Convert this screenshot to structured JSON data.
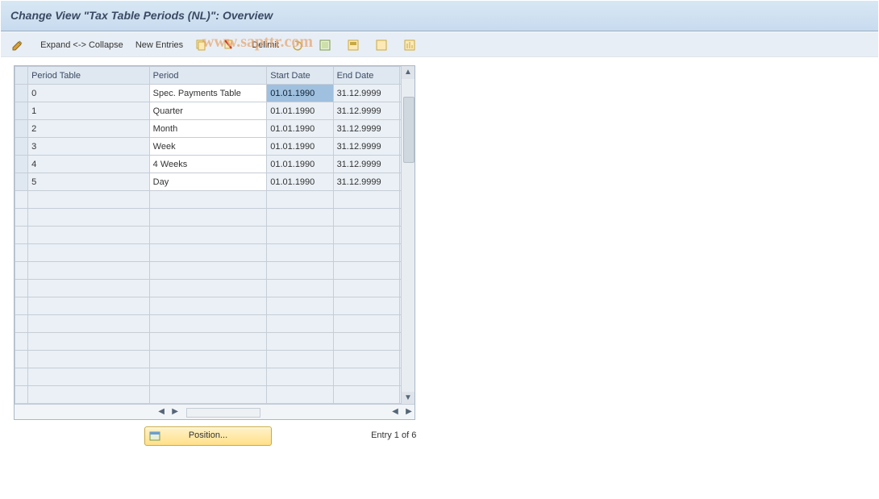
{
  "title": "Change View \"Tax Table Periods (NL)\": Overview",
  "watermark": "www.sapttr.com",
  "toolbar": {
    "expand_collapse": "Expand <-> Collapse",
    "new_entries": "New Entries",
    "delimit": "Delimit"
  },
  "columns": {
    "period_table": "Period Table",
    "period": "Period",
    "start_date": "Start Date",
    "end_date": "End Date"
  },
  "rows": [
    {
      "period_table": "0",
      "period": "Spec. Payments Table",
      "start_date": "01.01.1990",
      "end_date": "31.12.9999"
    },
    {
      "period_table": "1",
      "period": "Quarter",
      "start_date": "01.01.1990",
      "end_date": "31.12.9999"
    },
    {
      "period_table": "2",
      "period": "Month",
      "start_date": "01.01.1990",
      "end_date": "31.12.9999"
    },
    {
      "period_table": "3",
      "period": "Week",
      "start_date": "01.01.1990",
      "end_date": "31.12.9999"
    },
    {
      "period_table": "4",
      "period": "4 Weeks",
      "start_date": "01.01.1990",
      "end_date": "31.12.9999"
    },
    {
      "period_table": "5",
      "period": "Day",
      "start_date": "01.01.1990",
      "end_date": "31.12.9999"
    }
  ],
  "empty_rows": 12,
  "position_button": "Position...",
  "entry_text": "Entry 1 of 6"
}
